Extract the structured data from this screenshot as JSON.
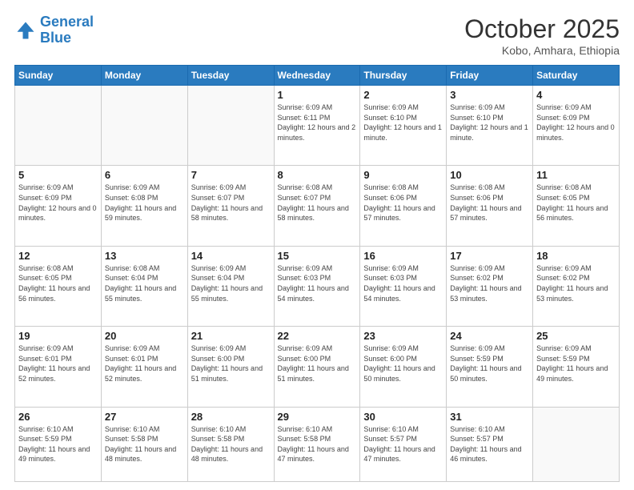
{
  "header": {
    "logo_line1": "General",
    "logo_line2": "Blue",
    "month": "October 2025",
    "location": "Kobo, Amhara, Ethiopia"
  },
  "weekdays": [
    "Sunday",
    "Monday",
    "Tuesday",
    "Wednesday",
    "Thursday",
    "Friday",
    "Saturday"
  ],
  "weeks": [
    [
      {
        "day": "",
        "info": ""
      },
      {
        "day": "",
        "info": ""
      },
      {
        "day": "",
        "info": ""
      },
      {
        "day": "1",
        "info": "Sunrise: 6:09 AM\nSunset: 6:11 PM\nDaylight: 12 hours and 2 minutes."
      },
      {
        "day": "2",
        "info": "Sunrise: 6:09 AM\nSunset: 6:10 PM\nDaylight: 12 hours and 1 minute."
      },
      {
        "day": "3",
        "info": "Sunrise: 6:09 AM\nSunset: 6:10 PM\nDaylight: 12 hours and 1 minute."
      },
      {
        "day": "4",
        "info": "Sunrise: 6:09 AM\nSunset: 6:09 PM\nDaylight: 12 hours and 0 minutes."
      }
    ],
    [
      {
        "day": "5",
        "info": "Sunrise: 6:09 AM\nSunset: 6:09 PM\nDaylight: 12 hours and 0 minutes."
      },
      {
        "day": "6",
        "info": "Sunrise: 6:09 AM\nSunset: 6:08 PM\nDaylight: 11 hours and 59 minutes."
      },
      {
        "day": "7",
        "info": "Sunrise: 6:09 AM\nSunset: 6:07 PM\nDaylight: 11 hours and 58 minutes."
      },
      {
        "day": "8",
        "info": "Sunrise: 6:08 AM\nSunset: 6:07 PM\nDaylight: 11 hours and 58 minutes."
      },
      {
        "day": "9",
        "info": "Sunrise: 6:08 AM\nSunset: 6:06 PM\nDaylight: 11 hours and 57 minutes."
      },
      {
        "day": "10",
        "info": "Sunrise: 6:08 AM\nSunset: 6:06 PM\nDaylight: 11 hours and 57 minutes."
      },
      {
        "day": "11",
        "info": "Sunrise: 6:08 AM\nSunset: 6:05 PM\nDaylight: 11 hours and 56 minutes."
      }
    ],
    [
      {
        "day": "12",
        "info": "Sunrise: 6:08 AM\nSunset: 6:05 PM\nDaylight: 11 hours and 56 minutes."
      },
      {
        "day": "13",
        "info": "Sunrise: 6:08 AM\nSunset: 6:04 PM\nDaylight: 11 hours and 55 minutes."
      },
      {
        "day": "14",
        "info": "Sunrise: 6:09 AM\nSunset: 6:04 PM\nDaylight: 11 hours and 55 minutes."
      },
      {
        "day": "15",
        "info": "Sunrise: 6:09 AM\nSunset: 6:03 PM\nDaylight: 11 hours and 54 minutes."
      },
      {
        "day": "16",
        "info": "Sunrise: 6:09 AM\nSunset: 6:03 PM\nDaylight: 11 hours and 54 minutes."
      },
      {
        "day": "17",
        "info": "Sunrise: 6:09 AM\nSunset: 6:02 PM\nDaylight: 11 hours and 53 minutes."
      },
      {
        "day": "18",
        "info": "Sunrise: 6:09 AM\nSunset: 6:02 PM\nDaylight: 11 hours and 53 minutes."
      }
    ],
    [
      {
        "day": "19",
        "info": "Sunrise: 6:09 AM\nSunset: 6:01 PM\nDaylight: 11 hours and 52 minutes."
      },
      {
        "day": "20",
        "info": "Sunrise: 6:09 AM\nSunset: 6:01 PM\nDaylight: 11 hours and 52 minutes."
      },
      {
        "day": "21",
        "info": "Sunrise: 6:09 AM\nSunset: 6:00 PM\nDaylight: 11 hours and 51 minutes."
      },
      {
        "day": "22",
        "info": "Sunrise: 6:09 AM\nSunset: 6:00 PM\nDaylight: 11 hours and 51 minutes."
      },
      {
        "day": "23",
        "info": "Sunrise: 6:09 AM\nSunset: 6:00 PM\nDaylight: 11 hours and 50 minutes."
      },
      {
        "day": "24",
        "info": "Sunrise: 6:09 AM\nSunset: 5:59 PM\nDaylight: 11 hours and 50 minutes."
      },
      {
        "day": "25",
        "info": "Sunrise: 6:09 AM\nSunset: 5:59 PM\nDaylight: 11 hours and 49 minutes."
      }
    ],
    [
      {
        "day": "26",
        "info": "Sunrise: 6:10 AM\nSunset: 5:59 PM\nDaylight: 11 hours and 49 minutes."
      },
      {
        "day": "27",
        "info": "Sunrise: 6:10 AM\nSunset: 5:58 PM\nDaylight: 11 hours and 48 minutes."
      },
      {
        "day": "28",
        "info": "Sunrise: 6:10 AM\nSunset: 5:58 PM\nDaylight: 11 hours and 48 minutes."
      },
      {
        "day": "29",
        "info": "Sunrise: 6:10 AM\nSunset: 5:58 PM\nDaylight: 11 hours and 47 minutes."
      },
      {
        "day": "30",
        "info": "Sunrise: 6:10 AM\nSunset: 5:57 PM\nDaylight: 11 hours and 47 minutes."
      },
      {
        "day": "31",
        "info": "Sunrise: 6:10 AM\nSunset: 5:57 PM\nDaylight: 11 hours and 46 minutes."
      },
      {
        "day": "",
        "info": ""
      }
    ]
  ]
}
